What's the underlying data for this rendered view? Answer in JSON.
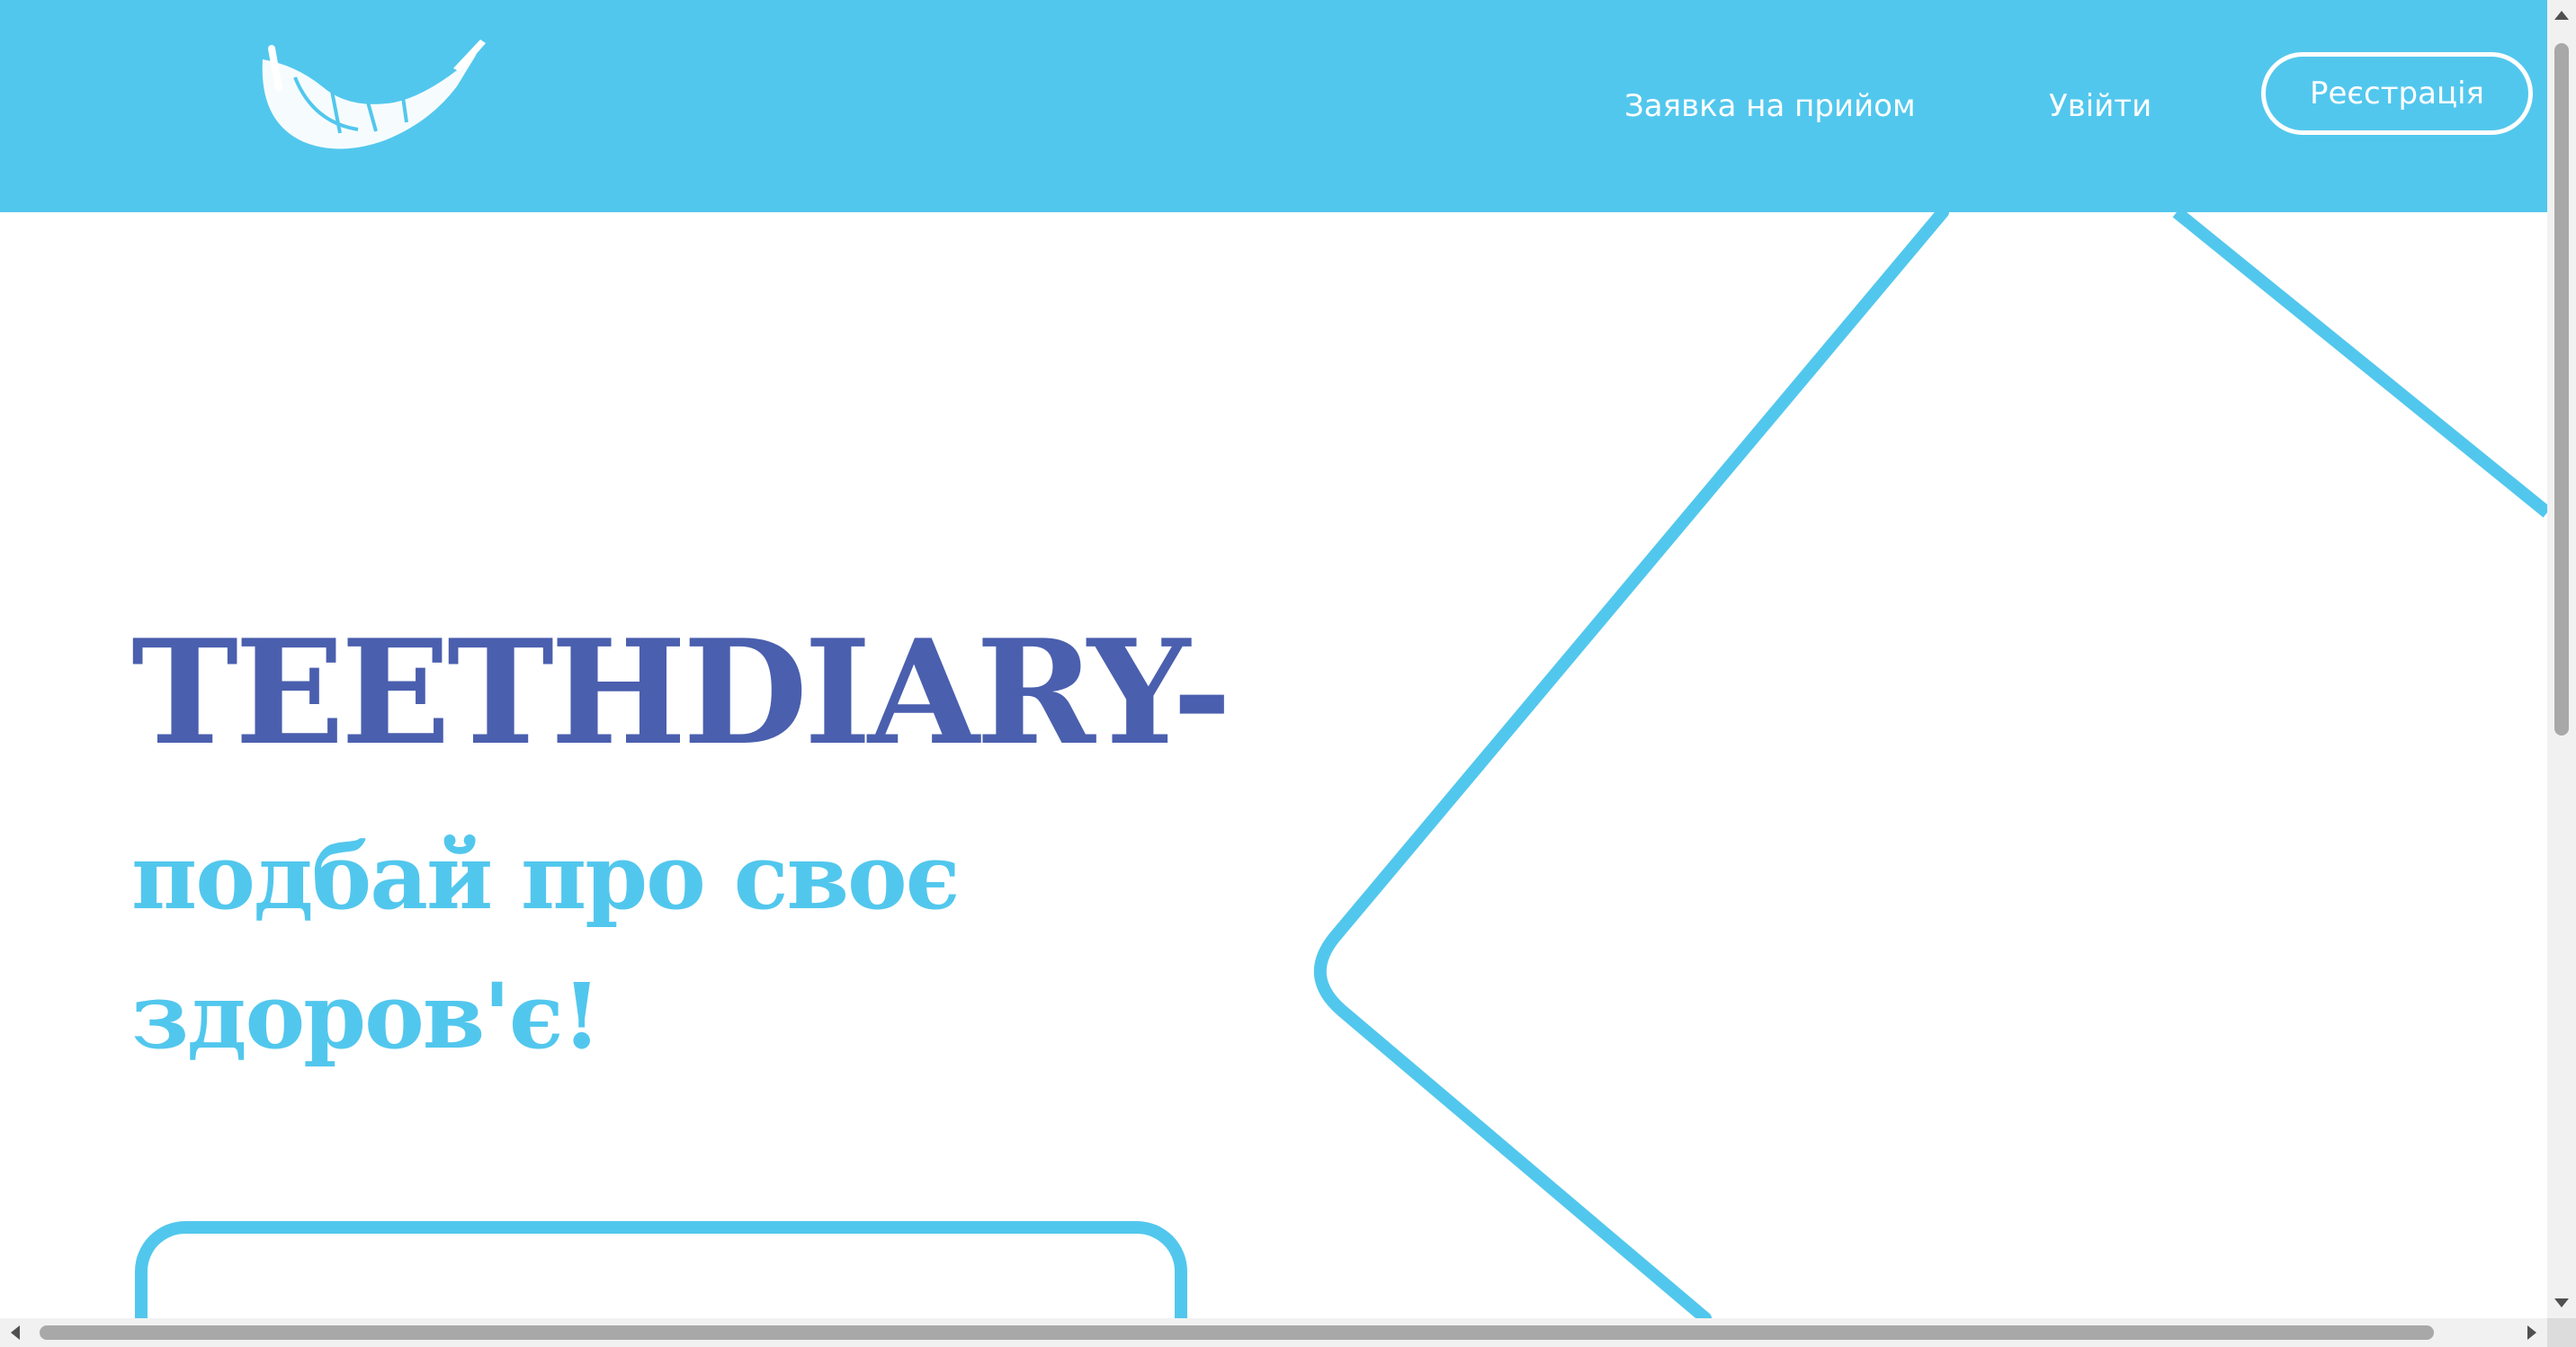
{
  "header": {
    "logo_icon": "tooth-feather-logo-icon",
    "nav": {
      "appointment_label": "Заявка на прийом",
      "login_label": "Увійти",
      "register_label": "Реєстрація"
    }
  },
  "hero": {
    "title": "TEETHDIARY-",
    "subtitle": "подбай про своє здоров'є!"
  },
  "colors": {
    "header_bg": "#52c7ed",
    "title": "#4a5fae",
    "subtitle": "#52c7ed",
    "accent": "#52c7ed",
    "text_on_header": "#ffffff"
  }
}
